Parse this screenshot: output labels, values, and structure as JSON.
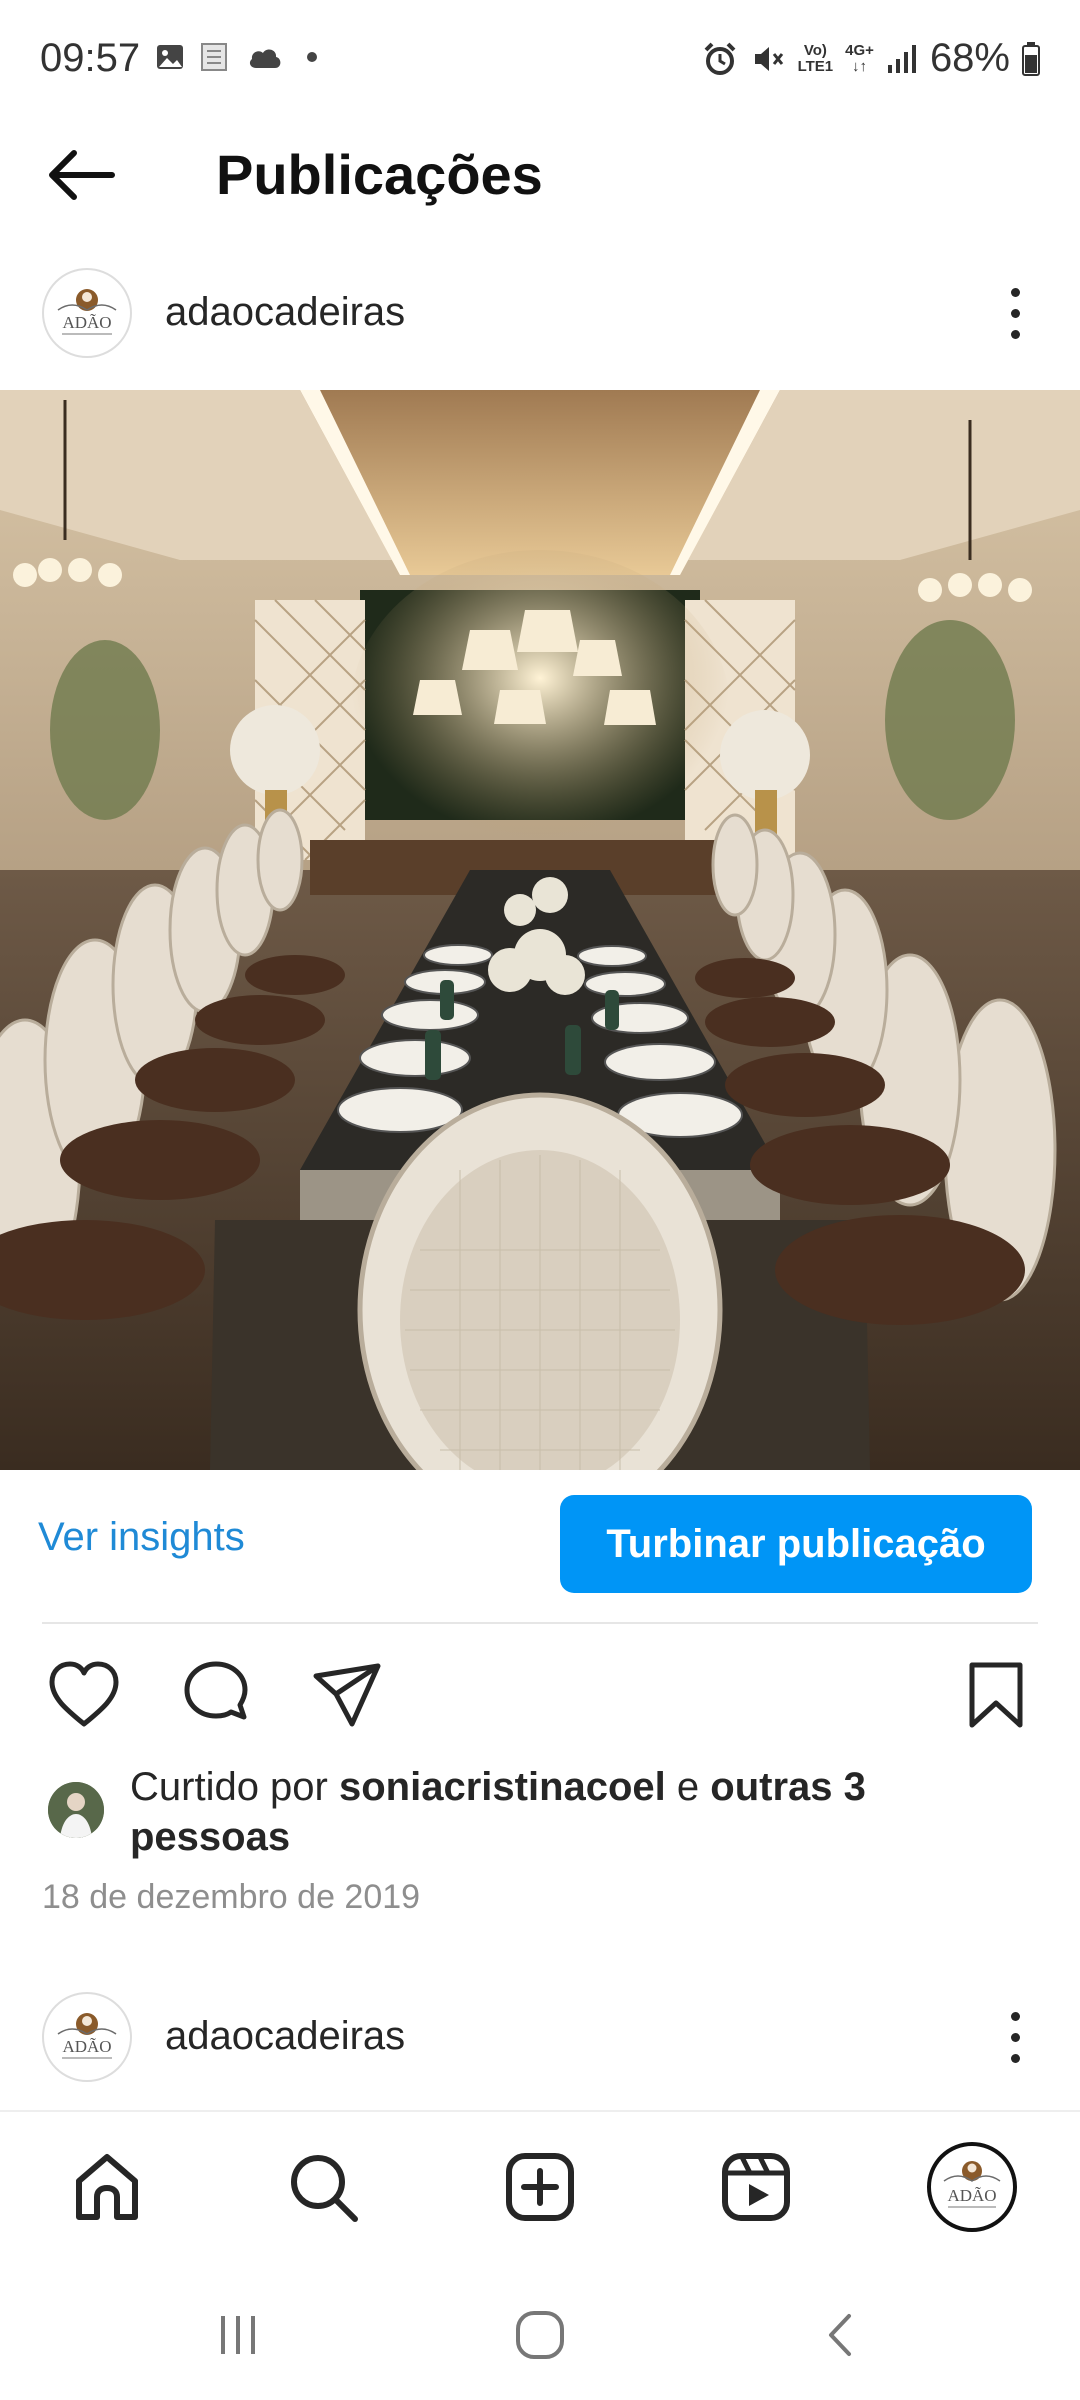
{
  "status_bar": {
    "time": "09:57",
    "battery": "68%",
    "volte_label_1": "Vo)",
    "volte_label_2": "LTE1",
    "network": "4G+"
  },
  "header": {
    "title": "Publicações"
  },
  "post": {
    "username": "adaocadeiras",
    "avatar_text": "ADÃO",
    "insights_label": "Ver insights",
    "boost_label": "Turbinar publicação",
    "likes_prefix": "Curtido por ",
    "likes_user": "soniacristinacoel",
    "likes_middle": " e ",
    "likes_others": "outras 3 pessoas",
    "date": "18 de dezembro de 2019"
  },
  "next_post": {
    "username": "adaocadeiras",
    "avatar_text": "ADÃO"
  },
  "bottom_nav": {
    "profile_avatar_text": "ADÃO"
  },
  "colors": {
    "accent": "#0095f6",
    "link": "#1f8ad6",
    "text": "#262626",
    "muted": "#8e8e8e"
  },
  "icons": [
    "back-arrow-icon",
    "more-vert-icon",
    "heart-icon",
    "comment-icon",
    "share-icon",
    "bookmark-icon",
    "home-icon",
    "search-icon",
    "add-post-icon",
    "reels-icon",
    "recent-apps-icon",
    "home-circle-icon",
    "back-chevron-icon"
  ]
}
